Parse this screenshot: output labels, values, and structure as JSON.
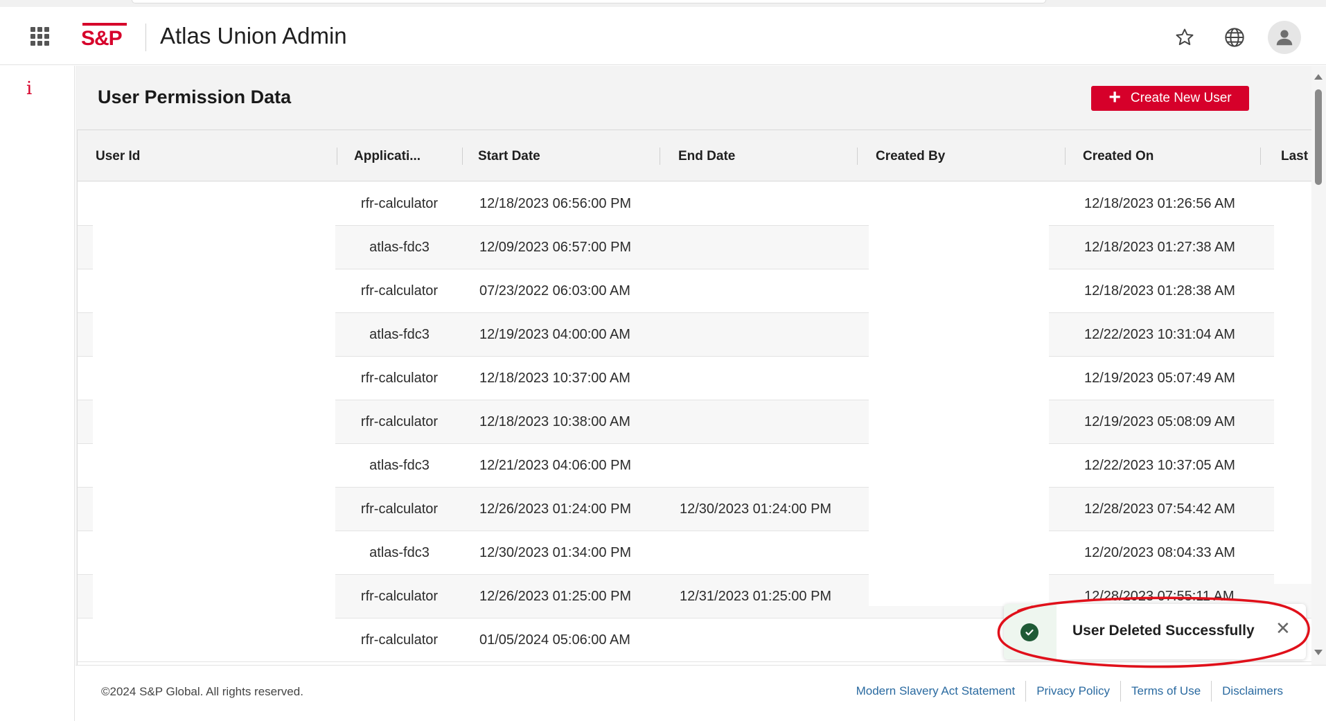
{
  "header": {
    "logo_text": "S&P",
    "app_title": "Atlas Union Admin"
  },
  "page": {
    "title": "User Permission Data",
    "create_button_label": "Create New User",
    "create_button_icon": "plus-icon"
  },
  "table": {
    "columns": [
      "User Id",
      "Applicati...",
      "Start Date",
      "End Date",
      "Created By",
      "Created On",
      "Last"
    ],
    "rows": [
      {
        "application": "rfr-calculator",
        "start_date": "12/18/2023 06:56:00 PM",
        "end_date": "",
        "created_on": "12/18/2023 01:26:56 AM"
      },
      {
        "application": "atlas-fdc3",
        "start_date": "12/09/2023 06:57:00 PM",
        "end_date": "",
        "created_on": "12/18/2023 01:27:38 AM"
      },
      {
        "application": "rfr-calculator",
        "start_date": "07/23/2022 06:03:00 AM",
        "end_date": "",
        "created_on": "12/18/2023 01:28:38 AM"
      },
      {
        "application": "atlas-fdc3",
        "start_date": "12/19/2023 04:00:00 AM",
        "end_date": "",
        "created_on": "12/22/2023 10:31:04 AM"
      },
      {
        "application": "rfr-calculator",
        "start_date": "12/18/2023 10:37:00 AM",
        "end_date": "",
        "created_on": "12/19/2023 05:07:49 AM"
      },
      {
        "application": "rfr-calculator",
        "start_date": "12/18/2023 10:38:00 AM",
        "end_date": "",
        "created_on": "12/19/2023 05:08:09 AM"
      },
      {
        "application": "atlas-fdc3",
        "start_date": "12/21/2023 04:06:00 PM",
        "end_date": "",
        "created_on": "12/22/2023 10:37:05 AM"
      },
      {
        "application": "rfr-calculator",
        "start_date": "12/26/2023 01:24:00 PM",
        "end_date": "12/30/2023 01:24:00 PM",
        "created_on": "12/28/2023 07:54:42 AM"
      },
      {
        "application": "atlas-fdc3",
        "start_date": "12/30/2023 01:34:00 PM",
        "end_date": "",
        "created_on": "12/20/2023 08:04:33 AM"
      },
      {
        "application": "rfr-calculator",
        "start_date": "12/26/2023 01:25:00 PM",
        "end_date": "12/31/2023 01:25:00 PM",
        "created_on": "12/28/2023 07:55:11 AM"
      },
      {
        "application": "rfr-calculator",
        "start_date": "01/05/2024 05:06:00 AM",
        "end_date": "",
        "created_on": ""
      }
    ]
  },
  "toast": {
    "message": "User Deleted Successfully",
    "close_symbol": "✕",
    "status_icon": "check-circle-icon"
  },
  "annotation": {
    "color": "#e0101a"
  },
  "footer": {
    "copyright": "©2024 S&P Global. All rights reserved.",
    "links": [
      "Modern Slavery Act Statement",
      "Privacy Policy",
      "Terms of Use",
      "Disclaimers"
    ]
  },
  "colors": {
    "brand_red": "#d6002a",
    "link_blue": "#2a6aa0",
    "success_green": "#1f5a36"
  }
}
